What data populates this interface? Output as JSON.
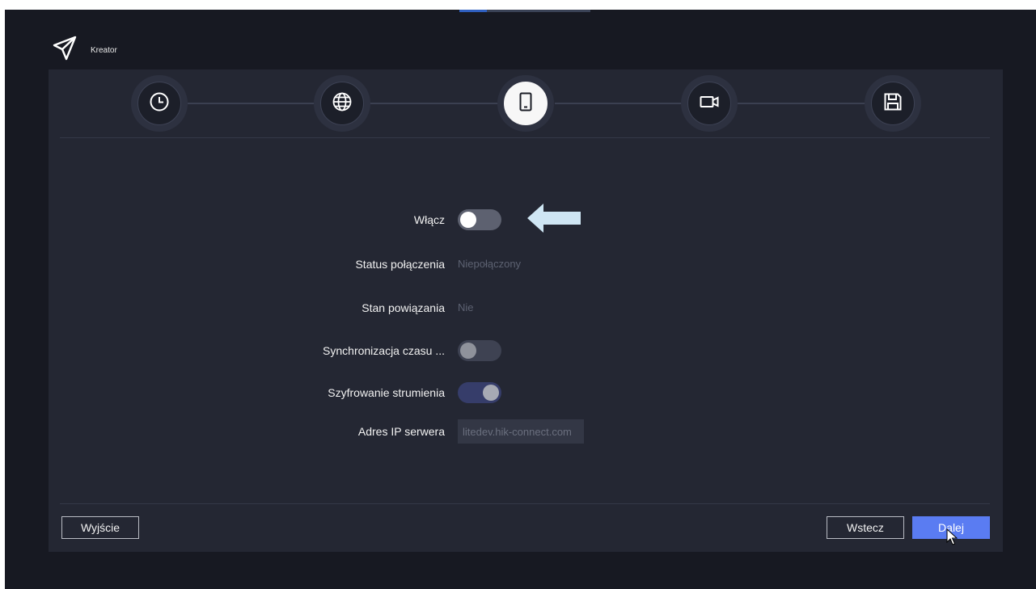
{
  "window": {
    "title": "Kreator",
    "logo_icon": "paper-plane-icon"
  },
  "steps": [
    {
      "icon": "clock-icon",
      "active": false
    },
    {
      "icon": "globe-icon",
      "active": false
    },
    {
      "icon": "mobile-icon",
      "active": true
    },
    {
      "icon": "camera-icon",
      "active": false
    },
    {
      "icon": "floppy-disk-icon",
      "active": false
    }
  ],
  "form": {
    "enable": {
      "label": "Włącz",
      "state": "off"
    },
    "connection_status": {
      "label": "Status połączenia",
      "value": "Niepołączony"
    },
    "binding_state": {
      "label": "Stan powiązania",
      "value": "Nie"
    },
    "time_sync": {
      "label": "Synchronizacja czasu ...",
      "state": "off"
    },
    "stream_encryption": {
      "label": "Szyfrowanie strumienia",
      "state": "on"
    },
    "server_ip": {
      "label": "Adres IP serwera",
      "value": "litedev.hik-connect.com"
    }
  },
  "annotation": {
    "icon": "arrow-left-icon",
    "color": "#cfe6f4"
  },
  "footer": {
    "exit_label": "Wyjście",
    "back_label": "Wstecz",
    "next_label": "Dalej"
  },
  "colors": {
    "accent": "#5a7cf2",
    "panel": "#242733",
    "background": "#171922"
  }
}
